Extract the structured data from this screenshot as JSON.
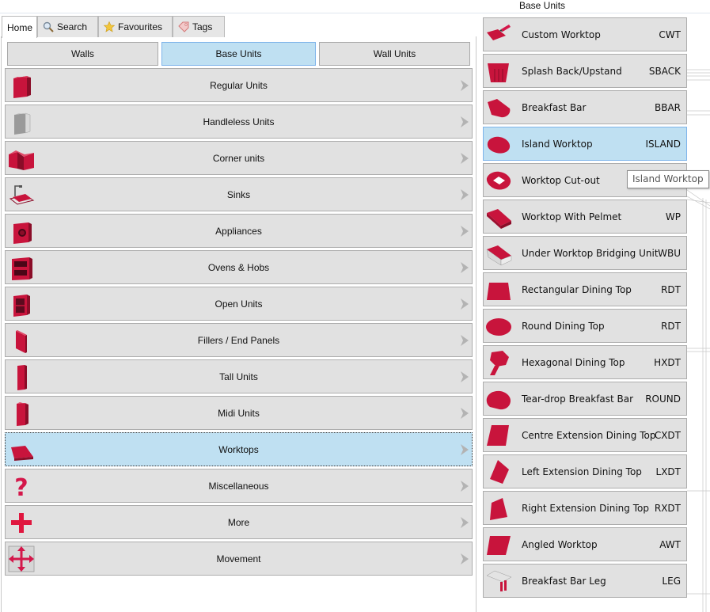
{
  "colors": {
    "accent": "#c8143c",
    "selected_bg": "#bfe0f2",
    "button_bg": "#e1e1e1"
  },
  "tabs": [
    {
      "label": "Home",
      "icon": "",
      "active": true
    },
    {
      "label": "Search",
      "icon": "search-icon"
    },
    {
      "label": "Favourites",
      "icon": "star-icon"
    },
    {
      "label": "Tags",
      "icon": "tag-icon"
    }
  ],
  "segments": [
    {
      "label": "Walls",
      "selected": false
    },
    {
      "label": "Base Units",
      "selected": true
    },
    {
      "label": "Wall Units",
      "selected": false
    }
  ],
  "categories": [
    {
      "label": "Regular Units",
      "icon": "regular-unit-icon"
    },
    {
      "label": "Handleless Units",
      "icon": "handleless-unit-icon"
    },
    {
      "label": "Corner units",
      "icon": "corner-unit-icon"
    },
    {
      "label": "Sinks",
      "icon": "sink-icon"
    },
    {
      "label": "Appliances",
      "icon": "appliance-icon"
    },
    {
      "label": "Ovens & Hobs",
      "icon": "oven-icon"
    },
    {
      "label": "Open Units",
      "icon": "open-unit-icon"
    },
    {
      "label": "Fillers / End Panels",
      "icon": "filler-panel-icon"
    },
    {
      "label": "Tall Units",
      "icon": "tall-unit-icon"
    },
    {
      "label": "Midi Units",
      "icon": "midi-unit-icon"
    },
    {
      "label": "Worktops",
      "icon": "worktop-icon",
      "selected": true
    },
    {
      "label": "Miscellaneous",
      "icon": "question-mark-icon"
    },
    {
      "label": "More",
      "icon": "plus-icon"
    },
    {
      "label": "Movement",
      "icon": "move-arrows-icon"
    }
  ],
  "right_panel": {
    "title": "Base Units",
    "items": [
      {
        "name": "Custom Worktop",
        "code": "CWT",
        "icon": "custom-worktop-icon"
      },
      {
        "name": "Splash Back/Upstand",
        "code": "SBACK",
        "icon": "splash-back-icon"
      },
      {
        "name": "Breakfast Bar",
        "code": "BBAR",
        "icon": "breakfast-bar-icon"
      },
      {
        "name": "Island Worktop",
        "code": "ISLAND",
        "icon": "island-worktop-icon",
        "selected": true
      },
      {
        "name": "Worktop Cut-out",
        "code": "",
        "icon": "worktop-cutout-icon"
      },
      {
        "name": "Worktop With Pelmet",
        "code": "WP",
        "icon": "worktop-pelmet-icon"
      },
      {
        "name": "Under Worktop Bridging Unit",
        "code": "WBU",
        "icon": "bridging-unit-icon"
      },
      {
        "name": "Rectangular Dining Top",
        "code": "RDT",
        "icon": "rectangular-dining-top-icon"
      },
      {
        "name": "Round Dining Top",
        "code": "RDT",
        "icon": "round-dining-top-icon"
      },
      {
        "name": "Hexagonal Dining Top",
        "code": "HXDT",
        "icon": "hexagonal-dining-top-icon"
      },
      {
        "name": "Tear-drop Breakfast Bar",
        "code": "ROUND",
        "icon": "teardrop-bar-icon"
      },
      {
        "name": "Centre Extension Dining Top",
        "code": "CXDT",
        "icon": "centre-extension-icon"
      },
      {
        "name": "Left Extension Dining Top",
        "code": "LXDT",
        "icon": "left-extension-icon"
      },
      {
        "name": "Right Extension Dining Top",
        "code": "RXDT",
        "icon": "right-extension-icon"
      },
      {
        "name": "Angled Worktop",
        "code": "AWT",
        "icon": "angled-worktop-icon"
      },
      {
        "name": "Breakfast Bar Leg",
        "code": "LEG",
        "icon": "breakfast-bar-leg-icon"
      }
    ]
  },
  "tooltip": {
    "text": "Island Worktop"
  }
}
